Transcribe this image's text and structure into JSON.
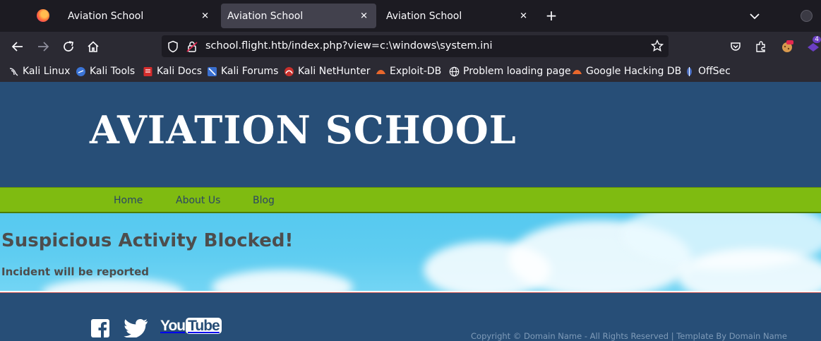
{
  "browser": {
    "tabs": [
      {
        "title": "Aviation School",
        "active": false
      },
      {
        "title": "Aviation School",
        "active": true
      },
      {
        "title": "Aviation School",
        "active": false
      }
    ],
    "url": "school.flight.htb/index.php?view=c:\\windows\\system.ini",
    "bookmarks": [
      {
        "label": "Kali Linux",
        "icon": "kali-dragon-icon"
      },
      {
        "label": "Kali Tools",
        "icon": "kali-tools-icon"
      },
      {
        "label": "Kali Docs",
        "icon": "kali-docs-icon"
      },
      {
        "label": "Kali Forums",
        "icon": "kali-forums-icon"
      },
      {
        "label": "Kali NetHunter",
        "icon": "nethunter-icon"
      },
      {
        "label": "Exploit-DB",
        "icon": "exploit-db-icon"
      },
      {
        "label": "Problem loading page",
        "icon": "globe-icon"
      },
      {
        "label": "Google Hacking DB",
        "icon": "ghdb-icon"
      },
      {
        "label": "OffSec",
        "icon": "offsec-icon"
      }
    ],
    "extension_badge": "4"
  },
  "site": {
    "title": "AVIATION SCHOOL",
    "menu": [
      "Home",
      "About Us",
      "Blog"
    ],
    "message": {
      "heading": "Suspicious Activity Blocked!",
      "subheading": "Incident will be reported"
    },
    "social": [
      "facebook-icon",
      "twitter-icon",
      "youtube-icon"
    ],
    "youtube_label": "YouTube",
    "copyright": "Copyright © Domain Name - All Rights Reserved | Template By Domain Name"
  },
  "colors": {
    "header_bg": "#274e77",
    "menu_bg": "#7fbb11",
    "sky_bg": "#56c9ef",
    "message_text": "#4d4d4d"
  }
}
